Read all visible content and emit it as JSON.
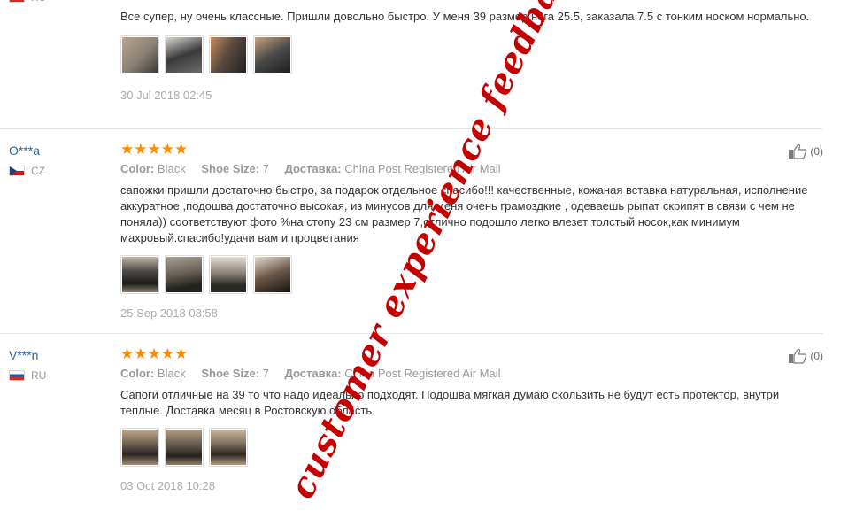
{
  "reviews": [
    {
      "text": "Все супер, ну очень классные. Пришли довольно быстро. У меня 39 размер нога 25.5, заказала 7.5 с тонким носком нормально.",
      "photos": [
        "#8a8074",
        "#3a3a3c",
        "#5c4a40",
        "#4a4a4a"
      ],
      "date": "30 Jul 2018 02:45"
    },
    {
      "user": "O***a",
      "country": "CZ",
      "stars": "★★★★★",
      "labels": {
        "color": "Color:",
        "size": "Shoe Size:",
        "delivery": "Доставка:"
      },
      "color": "Black",
      "size": "7",
      "delivery": "China Post Registered Air Mail",
      "text": "сапожки пришли достаточно быстро, за подарок отдельное спасибо!!! качественные, кожаная вставка натуральная, исполнение аккуратное ,подошва достаточно высокая, из минусов для меня очень грамоздкие , одеваешь рыпат скрипят в связи с чем не поняла)) соответствуют фото %на стопу 23 см размер 7,отлично подошло легко влезет толстый носок,как минимум махровый.спасибо!удачи вам и процветания",
      "photos": [
        "#4c4a47",
        "#6a6258",
        "#8d8478",
        "#6b5646"
      ],
      "date": "25 Sep 2018 08:58",
      "helpful": "(0)"
    },
    {
      "user": "V***n",
      "country": "RU",
      "stars": "★★★★★",
      "labels": {
        "color": "Color:",
        "size": "Shoe Size:",
        "delivery": "Доставка:"
      },
      "color": "Black",
      "size": "7",
      "delivery": "China Post Registered Air Mail",
      "text": "Сапоги отличные на 39 то что надо идеально подходят. Подошва мягкая думаю скользить не будут есть протектор, внутри теплые. Доставка месяц в Ростовскую область.",
      "photos": [
        "#7a6a5a",
        "#6c5f52",
        "#8a7a68"
      ],
      "date": "03 Oct 2018 10:28",
      "helpful": "(0)"
    }
  ],
  "watermark": "customer experience feedback"
}
